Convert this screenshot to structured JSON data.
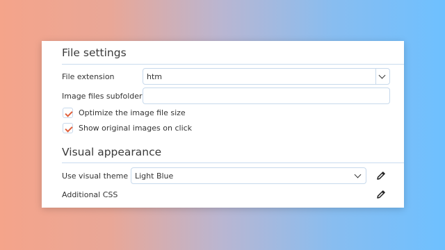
{
  "file_settings": {
    "title": "File settings",
    "file_extension": {
      "label": "File extension",
      "value": "htm"
    },
    "image_subfolder": {
      "label": "Image files subfolder",
      "value": ""
    },
    "optimize": {
      "label": "Optimize the image file size",
      "checked": true
    },
    "show_original": {
      "label": "Show original images on click",
      "checked": true
    }
  },
  "visual_appearance": {
    "title": "Visual appearance",
    "theme": {
      "label": "Use visual theme",
      "value": "Light Blue"
    },
    "css": {
      "label": "Additional CSS"
    }
  },
  "colors": {
    "accent_check": "#e0603c",
    "border": "#c7d9ec"
  },
  "icons": [
    "chevron-down-icon",
    "check-icon",
    "pencil-icon"
  ]
}
